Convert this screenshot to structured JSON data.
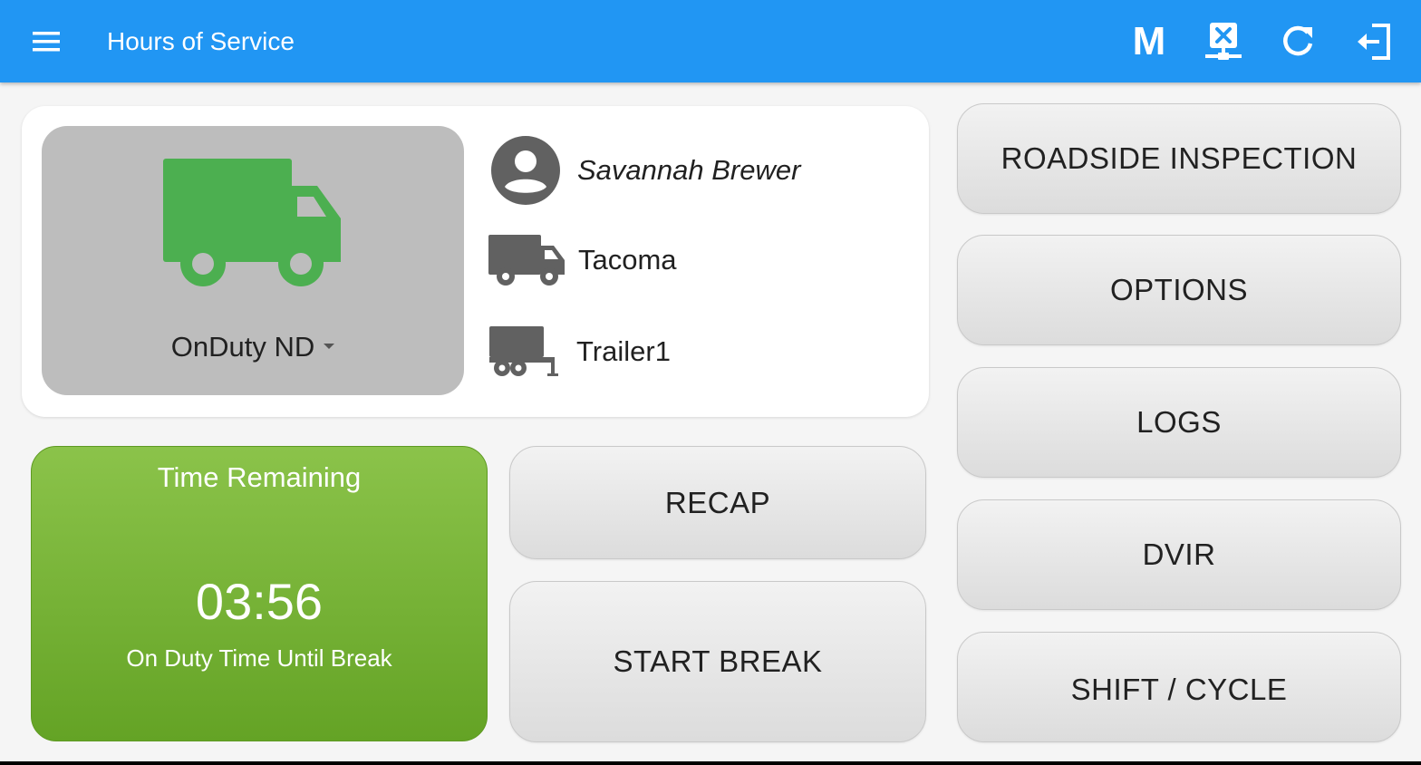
{
  "appbar": {
    "title": "Hours of Service",
    "menu_icon": "menu-icon",
    "mode_label": "M",
    "actions": [
      "mode-m-icon",
      "device-disconnected-icon",
      "refresh-icon",
      "logout-icon"
    ]
  },
  "driver": {
    "name": "Savannah Brewer",
    "vehicle": "Tacoma",
    "trailer": "Trailer1",
    "status": "OnDuty ND",
    "status_color": "#4caf50"
  },
  "time_remaining": {
    "title": "Time Remaining",
    "value": "03:56",
    "label": "On Duty Time Until Break",
    "color": "#8bc34a"
  },
  "buttons": {
    "recap": "RECAP",
    "start_break": "START BREAK",
    "roadside_inspection": "ROADSIDE INSPECTION",
    "options": "OPTIONS",
    "logs": "LOGS",
    "dvir": "DVIR",
    "shift_cycle": "SHIFT / CYCLE"
  },
  "colors": {
    "appbar": "#2196f3",
    "status_box": "#bdbdbd"
  }
}
